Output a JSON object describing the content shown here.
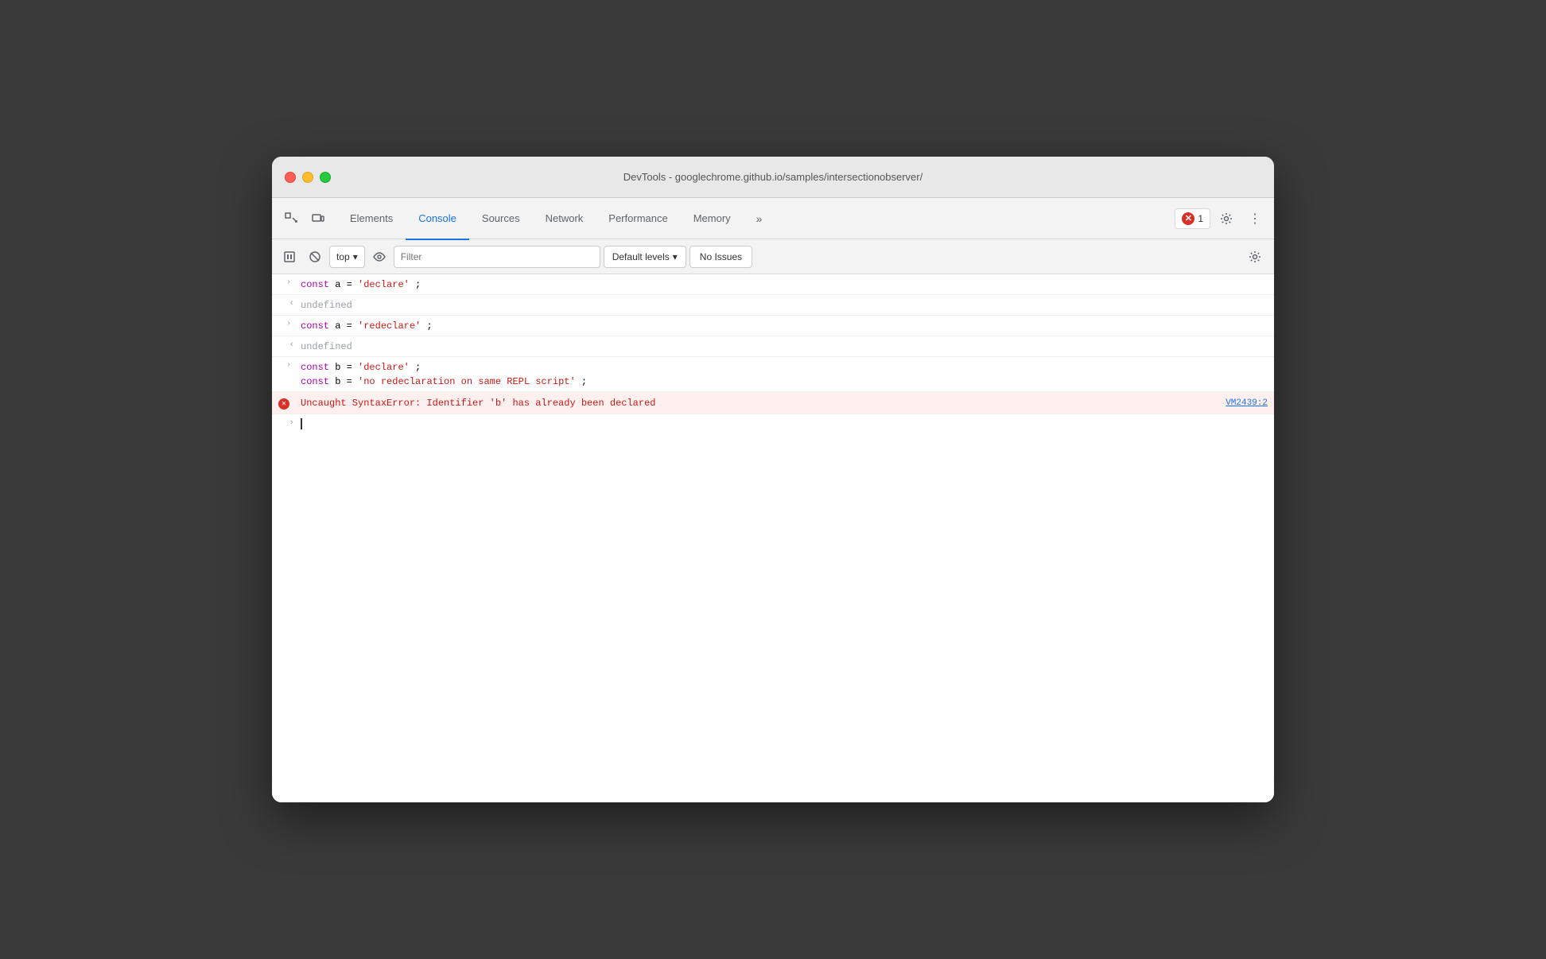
{
  "window": {
    "title": "DevTools - googlechrome.github.io/samples/intersectionobserver/"
  },
  "tabs": {
    "items": [
      {
        "label": "Elements",
        "active": false
      },
      {
        "label": "Console",
        "active": true
      },
      {
        "label": "Sources",
        "active": false
      },
      {
        "label": "Network",
        "active": false
      },
      {
        "label": "Performance",
        "active": false
      },
      {
        "label": "Memory",
        "active": false
      }
    ],
    "more_label": "»",
    "error_count": "1",
    "settings_label": "⚙",
    "more_options_label": "⋮"
  },
  "console_toolbar": {
    "execute_label": "▶",
    "clear_label": "🚫",
    "context_label": "top",
    "eye_label": "👁",
    "filter_placeholder": "Filter",
    "levels_label": "Default levels",
    "levels_arrow": "▾",
    "no_issues_label": "No Issues",
    "settings_label": "⚙"
  },
  "console_lines": [
    {
      "type": "input",
      "arrow": "›",
      "html": "const a = 'declare';"
    },
    {
      "type": "output",
      "arrow": "‹",
      "text": "undefined"
    },
    {
      "type": "input",
      "arrow": "›",
      "html": "const a = 'redeclare';"
    },
    {
      "type": "output",
      "arrow": "‹",
      "text": "undefined"
    },
    {
      "type": "input",
      "arrow": "›",
      "html_line1": "const b = 'declare';",
      "html_line2": "const b = 'no redeclaration on same REPL script';"
    },
    {
      "type": "error",
      "icon": "✕",
      "text": "Uncaught SyntaxError: Identifier 'b' has already been declared",
      "source": "VM2439:2"
    }
  ]
}
